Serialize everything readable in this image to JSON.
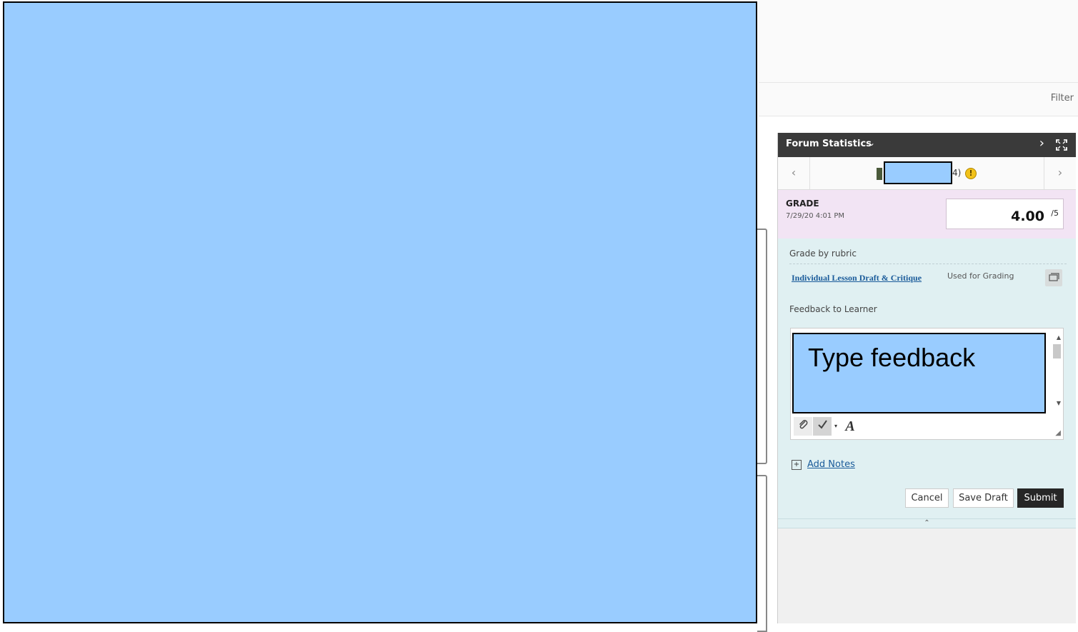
{
  "toolbar": {
    "filter_label": "Filter"
  },
  "panel": {
    "title": "Forum Statistics",
    "student": {
      "attempt_suffix": "4)"
    },
    "grade": {
      "label": "GRADE",
      "date": "7/29/20 4:01 PM",
      "value": "4.00",
      "max": "/5"
    },
    "rubric": {
      "heading": "Grade by rubric",
      "link": "Individual Lesson Draft & Critique",
      "used_for": "Used for Grading"
    },
    "feedback": {
      "heading": "Feedback to Learner",
      "placeholder": "Type feedback"
    },
    "notes_link": "Add Notes",
    "buttons": {
      "cancel": "Cancel",
      "save_draft": "Save Draft",
      "submit": "Submit"
    }
  },
  "icons": {
    "prev": "chevron-left-icon",
    "next": "chevron-right-icon",
    "expand": "expand-icon",
    "warning": "warning-icon",
    "attach": "paperclip-icon",
    "spellcheck": "spellcheck-icon",
    "format": "text-format-icon",
    "notes": "notes-icon"
  }
}
